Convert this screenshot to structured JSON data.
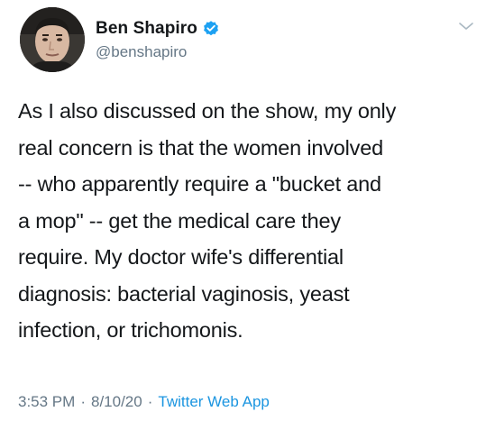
{
  "author": {
    "display_name": "Ben Shapiro",
    "handle": "@benshapiro",
    "verified": true
  },
  "tweet": {
    "lines": [
      "As I also discussed on the show, my only",
      "real concern is that the women involved",
      "-- who apparently require a \"bucket and",
      "a mop\" -- get the medical care they",
      "require. My doctor wife's differential",
      "diagnosis: bacterial vaginosis, yeast",
      "infection, or trichomonis."
    ],
    "time": "3:53 PM",
    "date": "8/10/20",
    "source": "Twitter Web App",
    "separator": "·"
  },
  "icons": {
    "verified": "verified-badge-icon",
    "caret": "chevron-down-icon"
  },
  "colors": {
    "text": "#14171a",
    "secondary": "#657786",
    "link": "#1b95e0",
    "verified": "#1da1f2"
  }
}
